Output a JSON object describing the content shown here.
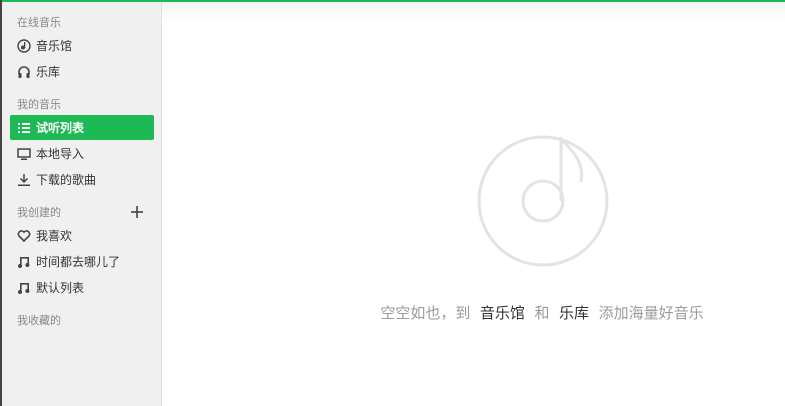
{
  "sidebar": {
    "online_section": "在线音乐",
    "online_items": [
      {
        "label": "音乐馆",
        "icon": "music-hall-icon"
      },
      {
        "label": "乐库",
        "icon": "headphones-icon"
      }
    ],
    "my_music_section": "我的音乐",
    "my_music_items": [
      {
        "label": "试听列表",
        "icon": "list-icon",
        "active": true
      },
      {
        "label": "本地导入",
        "icon": "monitor-icon"
      },
      {
        "label": "下载的歌曲",
        "icon": "download-icon"
      }
    ],
    "created_section": "我创建的",
    "created_items": [
      {
        "label": "我喜欢",
        "icon": "heart-icon"
      },
      {
        "label": "时间都去哪儿了",
        "icon": "music-note-icon"
      },
      {
        "label": "默认列表",
        "icon": "music-note-icon"
      }
    ],
    "collected_section": "我收藏的"
  },
  "main": {
    "empty_text_prefix": "空空如也，到",
    "link_music_hall": "音乐馆",
    "conj": "和",
    "link_library": "乐库",
    "empty_text_suffix": "添加海量好音乐"
  },
  "colors": {
    "accent": "#1db954"
  }
}
